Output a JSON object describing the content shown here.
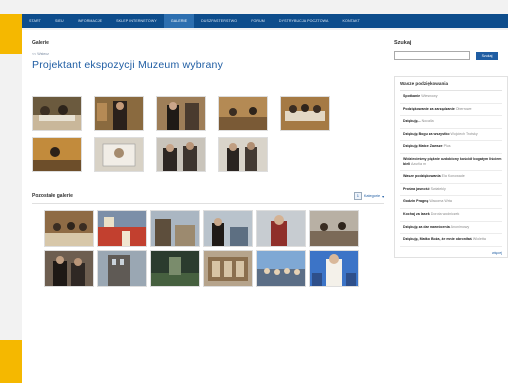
{
  "nav": [
    {
      "label": "Start",
      "active": false
    },
    {
      "label": "Sieu",
      "active": false
    },
    {
      "label": "Informacje",
      "active": false
    },
    {
      "label": "Sklep internetowy",
      "active": false
    },
    {
      "label": "Galerie",
      "active": true
    },
    {
      "label": "Duszpasterstwo",
      "active": false
    },
    {
      "label": "Forum",
      "active": false
    },
    {
      "label": "Dystrybucja pocztowa",
      "active": false
    },
    {
      "label": "Kontakt",
      "active": false
    }
  ],
  "main": {
    "section_label": "Galerie",
    "back_link": "<< Wstecz",
    "gallery_title": "Projektant ekspozycji Muzeum wybrany"
  },
  "others": {
    "label": "Pozostałe galerie",
    "category_box": "1",
    "category_select": "Kategorie"
  },
  "sidebar": {
    "search_label": "Szukaj",
    "search_value": "",
    "search_button": "Szukaj",
    "thanks_title": "Wasze podziękowania",
    "items": [
      {
        "title": "Spotkanie",
        "author": "Wiesnowy"
      },
      {
        "title": "Podziękowanie za zarządzanie",
        "author": "Oberrowe"
      },
      {
        "title": "Dziękuję...",
        "author": "Nocalla"
      },
      {
        "title": "Dziękuję Bogu za wszystko",
        "author": "Wojciech Trotsky"
      },
      {
        "title": "Dziękuję Matce Zawsze",
        "author": "Plus"
      },
      {
        "title": "Widziecieśmy pięknie ozdobiony kościół bogatym liściem bieli",
        "author": "Azurlia m"
      },
      {
        "title": "Wasze podziękowania",
        "author": "Ela Konowade"
      },
      {
        "title": "Prośna jasność",
        "author": "Swiatekly"
      },
      {
        "title": "Godzin Pragnę",
        "author": "Wacoma Wrta"
      },
      {
        "title": "Kochaj za lasek",
        "author": "Dorota wodniczek"
      },
      {
        "title": "Dziękuję za dar nawrócenia",
        "author": "Anonimowy"
      },
      {
        "title": "Dziękuję, Matko Boża, że mnie obroniłaś",
        "author": "Wioletta"
      }
    ],
    "more_link": "więcej"
  },
  "colors": {
    "nav_bg": "#0e4d8c",
    "nav_active": "#2d6fb0",
    "title_blue": "#1f5da3",
    "accent_yellow": "#f5b800"
  },
  "thumbs_top": [
    "photo-1",
    "photo-2",
    "photo-3",
    "photo-4",
    "photo-5",
    "photo-6",
    "photo-7",
    "photo-8",
    "photo-9"
  ],
  "thumbs_others": [
    "gal-1",
    "gal-2",
    "gal-3",
    "gal-4",
    "gal-5",
    "gal-6",
    "gal-7",
    "gal-8",
    "gal-9",
    "gal-10",
    "gal-11",
    "gal-12"
  ]
}
